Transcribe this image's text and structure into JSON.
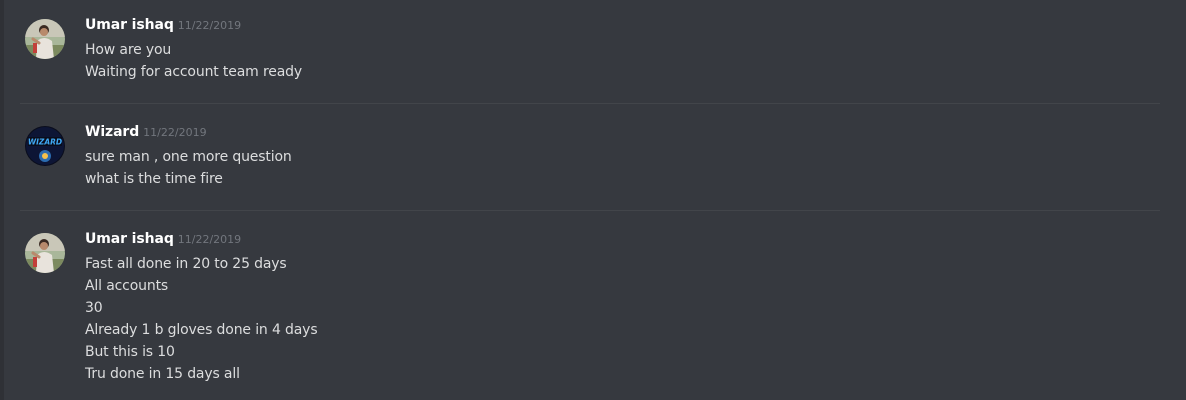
{
  "messages": [
    {
      "author": "Umar ishaq",
      "timestamp": "11/22/2019",
      "avatar_icon": "user-photo-avatar-icon",
      "lines": [
        "How are you",
        "Waiting for account team ready"
      ]
    },
    {
      "author": "Wizard",
      "timestamp": "11/22/2019",
      "avatar_icon": "wizard-logo-avatar-icon",
      "avatar_text": "WIZARD",
      "lines": [
        "sure man , one more question",
        "what is the time fire"
      ]
    },
    {
      "author": "Umar ishaq",
      "timestamp": "11/22/2019",
      "avatar_icon": "user-photo-avatar-icon",
      "lines": [
        "Fast all done in 20 to 25 days",
        "All accounts",
        "30",
        "Already 1 b gloves done in 4 days",
        "But this is 10",
        "Tru done in 15 days all"
      ]
    }
  ],
  "colors": {
    "background": "#36393f",
    "username": "#ffffff",
    "timestamp": "#72767d",
    "text": "#dcddde",
    "divider": "#42454a",
    "wizard_text": "#3fa9f5"
  }
}
